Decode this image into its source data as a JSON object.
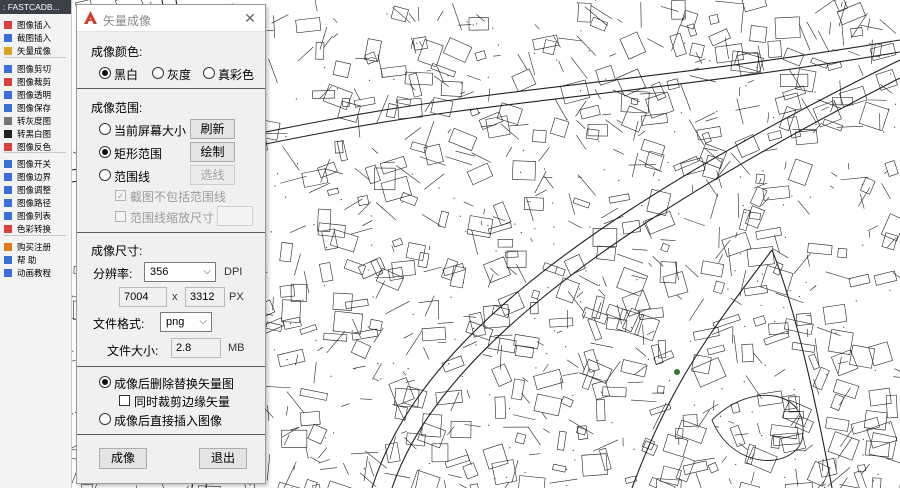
{
  "toolbar": {
    "title": ": FASTCADB...",
    "items": [
      {
        "label": "图像插入",
        "icon": "image-insert-icon",
        "color": "#d94040"
      },
      {
        "label": "截图插入",
        "icon": "screenshot-insert-icon",
        "color": "#3a6fd8"
      },
      {
        "label": "矢量成像",
        "icon": "vector-image-icon",
        "color": "#d9a520"
      },
      {
        "label": "图像剪切",
        "icon": "image-cut-icon",
        "color": "#3a6fd8"
      },
      {
        "label": "图像裁剪",
        "icon": "image-crop-icon",
        "color": "#d94040"
      },
      {
        "label": "图像透明",
        "icon": "image-transparent-icon",
        "color": "#3a6fd8"
      },
      {
        "label": "图像保存",
        "icon": "image-save-icon",
        "color": "#3a6fd8"
      },
      {
        "label": "转灰度图",
        "icon": "grayscale-icon",
        "color": "#777777"
      },
      {
        "label": "转黑白图",
        "icon": "black-white-icon",
        "color": "#222222"
      },
      {
        "label": "图像反色",
        "icon": "invert-icon",
        "color": "#d94040"
      },
      {
        "label": "图像开关",
        "icon": "image-toggle-icon",
        "color": "#3a6fd8"
      },
      {
        "label": "图像边界",
        "icon": "image-border-icon",
        "color": "#3a6fd8"
      },
      {
        "label": "图像调整",
        "icon": "image-adjust-icon",
        "color": "#3a6fd8"
      },
      {
        "label": "图像路径",
        "icon": "image-path-icon",
        "color": "#3a6fd8"
      },
      {
        "label": "图像列表",
        "icon": "image-list-icon",
        "color": "#3a6fd8"
      },
      {
        "label": "色彩转换",
        "icon": "color-convert-icon",
        "color": "#d94040"
      },
      {
        "label": "购买注册",
        "icon": "purchase-icon",
        "color": "#e07a1a"
      },
      {
        "label": "帮  助",
        "icon": "help-icon",
        "color": "#3a6fd8"
      },
      {
        "label": "动画教程",
        "icon": "tutorial-icon",
        "color": "#3a6fd8"
      }
    ]
  },
  "dialog": {
    "title": "矢量成像",
    "close_icon": "close-icon",
    "color_section": {
      "label": "成像颜色:",
      "options": [
        "黑白",
        "灰度",
        "真彩色"
      ],
      "selected": "黑白"
    },
    "range_section": {
      "label": "成像范围:",
      "opt_screen": "当前屏幕大小",
      "refresh_btn": "刷新",
      "opt_rect": "矩形范围",
      "draw_btn": "绘制",
      "opt_boundary": "范围线",
      "select_line_btn": "选线",
      "chk_exclude": "截图不包括范围线",
      "chk_exclude_checked": "✓",
      "chk_scale": "范围线缩放尺寸",
      "selected": "矩形范围"
    },
    "size_section": {
      "label": "成像尺寸:",
      "resolution_label": "分辨率:",
      "resolution_value": "356",
      "dpi_unit": "DPI",
      "width": "7004",
      "x_sep": "x",
      "height": "3312",
      "px_unit": "PX",
      "format_label": "文件格式:",
      "format_value": "png",
      "filesize_label": "文件大小:",
      "filesize_value": "2.8",
      "mb_unit": "MB"
    },
    "after_section": {
      "opt_replace": "成像后删除替换矢量图",
      "chk_crop_edge": "同时裁剪边缘矢量",
      "opt_insert": "成像后直接插入图像",
      "selected": "成像后删除替换矢量图"
    },
    "buttons": {
      "ok": "成像",
      "exit": "退出"
    }
  }
}
